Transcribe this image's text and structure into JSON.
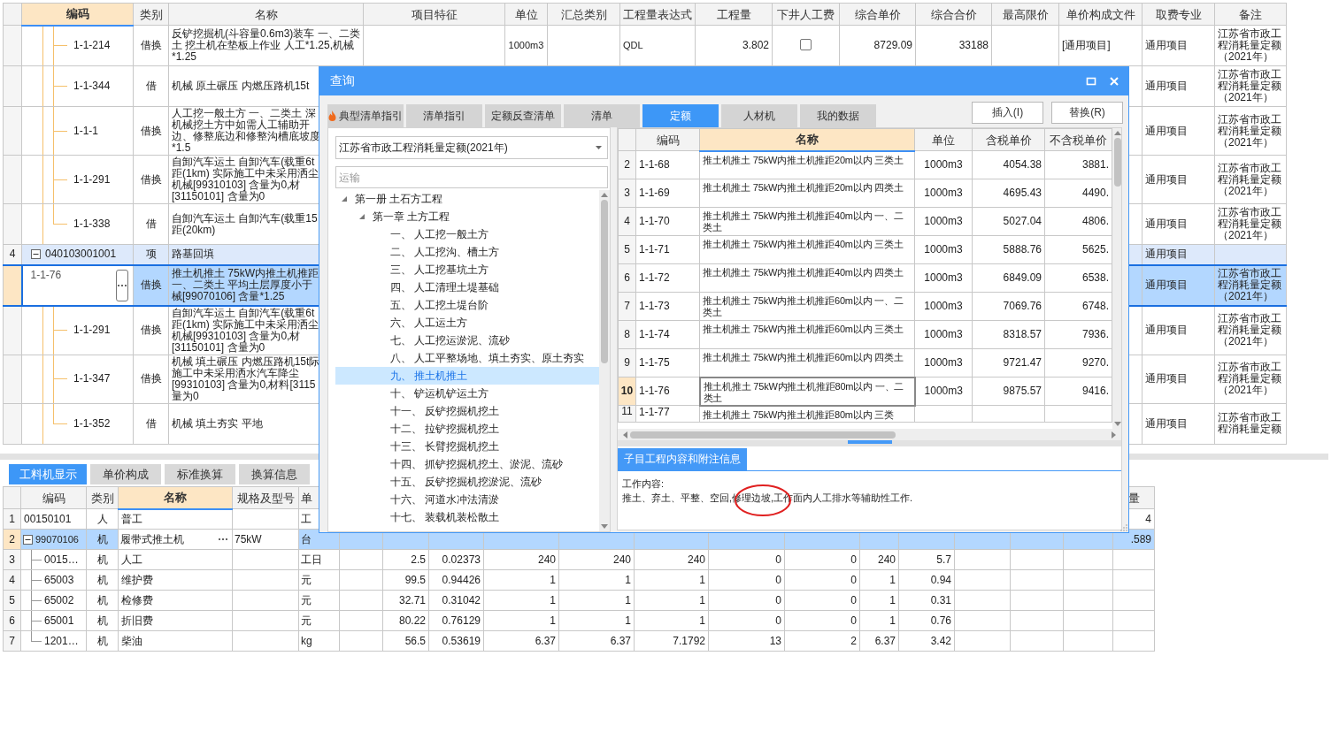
{
  "main_table": {
    "columns": [
      {
        "label": "编码",
        "selected": true
      },
      {
        "label": "类别",
        "selected": false
      },
      {
        "label": "名称",
        "selected": false
      },
      {
        "label": "项目特征",
        "selected": false
      },
      {
        "label": "单位",
        "selected": false
      },
      {
        "label": "汇总类别",
        "selected": false
      },
      {
        "label": "工程量表达式",
        "selected": false
      },
      {
        "label": "工程量",
        "selected": false
      },
      {
        "label": "下井人工费",
        "selected": false
      },
      {
        "label": "综合单价",
        "selected": false
      },
      {
        "label": "综合合价",
        "selected": false
      },
      {
        "label": "最高限价",
        "selected": false
      },
      {
        "label": "单价构成文件",
        "selected": false
      },
      {
        "label": "取费专业",
        "selected": false
      },
      {
        "label": "备注",
        "selected": false
      }
    ],
    "rows": [
      {
        "children": [
          {
            "code": "1-1-214",
            "type": "借换",
            "name": "反铲挖掘机(斗容量0.6m3)装车 一、二类土 挖土机在垫板上作业 人工*1.25,机械*1.25",
            "unit": "1000m3",
            "expression": "QDL",
            "quantity": "3.802",
            "labor_checked": false,
            "unit_price": "8729.09",
            "total_price": "33188",
            "price_file": "[通用项目]",
            "fee_specialty": "通用项目",
            "remark": "江苏省市政工程消耗量定额（2021年）",
            "selected": false
          },
          {
            "code": "1-1-344",
            "type": "借",
            "name": "机械 原土碾压 内燃压路机15t",
            "fee_specialty": "通用项目",
            "remark": "江苏省市政工程消耗量定额（2021年）",
            "selected": false
          },
          {
            "code": "1-1-1",
            "type": "借换",
            "name": "人工挖一般土方 一、二类土 深机械挖土方中如需人工辅助开边、修整底边和修整沟槽底坡度*1.5",
            "fee_specialty": "通用项目",
            "remark": "江苏省市政工程消耗量定额（2021年）",
            "selected": false
          },
          {
            "code": "1-1-291",
            "type": "借换",
            "name": "自卸汽车运土 自卸汽车(载重6t距(1km) 实际施工中未采用洒尘机械[99310103] 含量为0,材[31150101] 含量为0",
            "fee_specialty": "通用项目",
            "remark": "江苏省市政工程消耗量定额（2021年）",
            "selected": false
          },
          {
            "code": "1-1-338",
            "type": "借",
            "name": "自卸汽车运土 自卸汽车(载重15距(20km)",
            "fee_specialty": "通用项目",
            "remark": "江苏省市政工程消耗量定额（2021年）",
            "selected": false
          }
        ]
      },
      {
        "num": "4",
        "code": "040103001001",
        "type": "项",
        "name": "路基回填",
        "fee_specialty": "通用项目",
        "expanded": true,
        "selected": false,
        "children": [
          {
            "code": "1-1-76",
            "type": "借换",
            "name": "推土机推土 75kW内推土机推距一、二类土 平均土层厚度小于械[99070106] 含量*1.25",
            "fee_specialty": "通用项目",
            "remark": "江苏省市政工程消耗量定额（2021年）",
            "selected": true
          },
          {
            "code": "1-1-291",
            "type": "借换",
            "name": "自卸汽车运土 自卸汽车(载重6t距(1km) 实际施工中未采用洒尘机械[99310103] 含量为0,材[31150101] 含量为0",
            "fee_specialty": "通用项目",
            "remark": "江苏省市政工程消耗量定额（2021年）",
            "selected": false
          },
          {
            "code": "1-1-347",
            "type": "借换",
            "name": "机械 填土碾压 内燃压路机15t际施工中未采用洒水汽车降尘[99310103] 含量为0,材料[3115量为0",
            "fee_specialty": "通用项目",
            "remark": "江苏省市政工程消耗量定额（2021年）",
            "selected": false
          },
          {
            "code": "1-1-352",
            "type": "借",
            "name": "机械 填土夯实 平地",
            "fee_specialty": "通用项目",
            "remark": "江苏省市政工程消耗量定额",
            "selected": false
          }
        ]
      }
    ]
  },
  "bottom_tabs": [
    {
      "label": "工料机显示",
      "selected": true
    },
    {
      "label": "单价构成",
      "selected": false
    },
    {
      "label": "标准换算",
      "selected": false
    },
    {
      "label": "换算信息",
      "selected": false
    }
  ],
  "resource_table": {
    "columns": [
      {
        "label": "编码",
        "selected": false
      },
      {
        "label": "类别",
        "selected": false
      },
      {
        "label": "名称",
        "selected": true
      },
      {
        "label": "规格及型号",
        "selected": false
      },
      {
        "label": "单",
        "selected": false
      }
    ],
    "right_column": "量",
    "rows": [
      {
        "num": "1",
        "code": "00150101",
        "type": "人",
        "name": "普工",
        "unit": "工",
        "right_value": "4",
        "selected": false
      },
      {
        "num": "2",
        "code": "99070106",
        "type": "机",
        "name": "履带式推土机",
        "spec": "75kW",
        "unit": "台",
        "right_value": ".589",
        "selected": true,
        "expanded": true,
        "children": [
          {
            "num": "3",
            "code": "0015…",
            "type": "机",
            "name": "人工",
            "unit": "工日",
            "values": [
              "2.5",
              "0.02373",
              "240",
              "240",
              "240",
              "0",
              "0",
              "240",
              "5.7"
            ],
            "selected": false
          },
          {
            "num": "4",
            "code": "65003",
            "type": "机",
            "name": "维护费",
            "unit": "元",
            "values": [
              "99.5",
              "0.94426",
              "1",
              "1",
              "1",
              "0",
              "0",
              "1",
              "0.94"
            ],
            "selected": false
          },
          {
            "num": "5",
            "code": "65002",
            "type": "机",
            "name": "检修费",
            "unit": "元",
            "values": [
              "32.71",
              "0.31042",
              "1",
              "1",
              "1",
              "0",
              "0",
              "1",
              "0.31"
            ],
            "selected": false
          },
          {
            "num": "6",
            "code": "65001",
            "type": "机",
            "name": "折旧费",
            "unit": "元",
            "values": [
              "80.22",
              "0.76129",
              "1",
              "1",
              "1",
              "0",
              "0",
              "1",
              "0.76"
            ],
            "selected": false
          },
          {
            "num": "7",
            "code": "1201…",
            "type": "机",
            "name": "柴油",
            "unit": "kg",
            "values": [
              "56.5",
              "0.53619",
              "6.37",
              "6.37",
              "7.1792",
              "13",
              "2",
              "6.37",
              "3.42"
            ],
            "selected": false
          }
        ]
      }
    ]
  },
  "dialog": {
    "title": "查询",
    "tabs": [
      {
        "label": "典型清单指引",
        "kind": "featured",
        "selected": false
      },
      {
        "label": "清单指引",
        "kind": "plain",
        "selected": false
      },
      {
        "label": "定额反查清单",
        "kind": "plain",
        "selected": false
      },
      {
        "label": "清单",
        "kind": "plain",
        "selected": false
      },
      {
        "label": "定额",
        "kind": "plain",
        "selected": true
      },
      {
        "label": "人材机",
        "kind": "plain",
        "selected": false
      },
      {
        "label": "我的数据",
        "kind": "plain",
        "selected": false
      }
    ],
    "buttons": [
      "插入(I)",
      "替换(R)"
    ],
    "library": "江苏省市政工程消耗量定额(2021年)",
    "search": {
      "placeholder": "运输"
    },
    "tree": [
      {
        "label": "第一册 土石方工程",
        "expanded": true,
        "selected": false,
        "children": [
          {
            "label": "第一章 土方工程",
            "expanded": true,
            "selected": false,
            "children": [
              {
                "label": "一、 人工挖一般土方",
                "selected": false
              },
              {
                "label": "二、 人工挖沟、槽土方",
                "selected": false
              },
              {
                "label": "三、 人工挖基坑土方",
                "selected": false
              },
              {
                "label": "四、 人工清理土堤基础",
                "selected": false
              },
              {
                "label": "五、 人工挖土堤台阶",
                "selected": false
              },
              {
                "label": "六、 人工运土方",
                "selected": false
              },
              {
                "label": "七、 人工挖运淤泥、流砂",
                "selected": false
              },
              {
                "label": "八、 人工平整场地、填土夯实、原土夯实",
                "selected": false
              },
              {
                "label": "九、 推土机推土",
                "selected": true
              },
              {
                "label": "十、 铲运机铲运土方",
                "selected": false
              },
              {
                "label": "十一、 反铲挖掘机挖土",
                "selected": false
              },
              {
                "label": "十二、 拉铲挖掘机挖土",
                "selected": false
              },
              {
                "label": "十三、 长臂挖掘机挖土",
                "selected": false
              },
              {
                "label": "十四、 抓铲挖掘机挖土、淤泥、流砂",
                "selected": false
              },
              {
                "label": "十五、 反铲挖掘机挖淤泥、流砂",
                "selected": false
              },
              {
                "label": "十六、 河道水冲法清淤",
                "selected": false
              },
              {
                "label": "十七、 装载机装松散土",
                "selected": false
              }
            ]
          }
        ]
      }
    ],
    "quota_table": {
      "columns": [
        {
          "label": "编码",
          "selected": false
        },
        {
          "label": "名称",
          "selected": true
        },
        {
          "label": "单位",
          "selected": false
        },
        {
          "label": "含税单价",
          "selected": false
        },
        {
          "label": "不含税单价",
          "selected": false
        }
      ],
      "rows": [
        {
          "num": "2",
          "code": "1-1-68",
          "name": "推土机推土 75kW内推土机推距20m以内 三类土",
          "unit": "1000m3",
          "tax_price": "4054.38",
          "net_price": "3881.",
          "selected": false
        },
        {
          "num": "3",
          "code": "1-1-69",
          "name": "推土机推土 75kW内推土机推距20m以内 四类土",
          "unit": "1000m3",
          "tax_price": "4695.43",
          "net_price": "4490.",
          "selected": false
        },
        {
          "num": "4",
          "code": "1-1-70",
          "name": "推土机推土 75kW内推土机推距40m以内 一、二类土",
          "unit": "1000m3",
          "tax_price": "5027.04",
          "net_price": "4806.",
          "selected": false
        },
        {
          "num": "5",
          "code": "1-1-71",
          "name": "推土机推土 75kW内推土机推距40m以内 三类土",
          "unit": "1000m3",
          "tax_price": "5888.76",
          "net_price": "5625.",
          "selected": false
        },
        {
          "num": "6",
          "code": "1-1-72",
          "name": "推土机推土 75kW内推土机推距40m以内 四类土",
          "unit": "1000m3",
          "tax_price": "6849.09",
          "net_price": "6538.",
          "selected": false
        },
        {
          "num": "7",
          "code": "1-1-73",
          "name": "推土机推土 75kW内推土机推距60m以内 一、二类土",
          "unit": "1000m3",
          "tax_price": "7069.76",
          "net_price": "6748.",
          "selected": false
        },
        {
          "num": "8",
          "code": "1-1-74",
          "name": "推土机推土 75kW内推土机推距60m以内 三类土",
          "unit": "1000m3",
          "tax_price": "8318.57",
          "net_price": "7936.",
          "selected": false
        },
        {
          "num": "9",
          "code": "1-1-75",
          "name": "推土机推土 75kW内推土机推距60m以内 四类土",
          "unit": "1000m3",
          "tax_price": "9721.47",
          "net_price": "9270.",
          "selected": false
        },
        {
          "num": "10",
          "code": "1-1-76",
          "name": "推土机推土 75kW内推土机推距80m以内 一、二类土",
          "unit": "1000m3",
          "tax_price": "9875.57",
          "net_price": "9416.",
          "selected": true
        },
        {
          "num": "11",
          "code": "1-1-77",
          "name": "推土机推土 75kW内推土机推距80m以内 三类",
          "selected": false
        }
      ]
    },
    "info": {
      "tab": "子目工程内容和附注信息",
      "heading": "工作内容:",
      "text": "推土、弃土、平整、空回,修理边坡,工作面内人工排水等辅助性工作."
    }
  }
}
